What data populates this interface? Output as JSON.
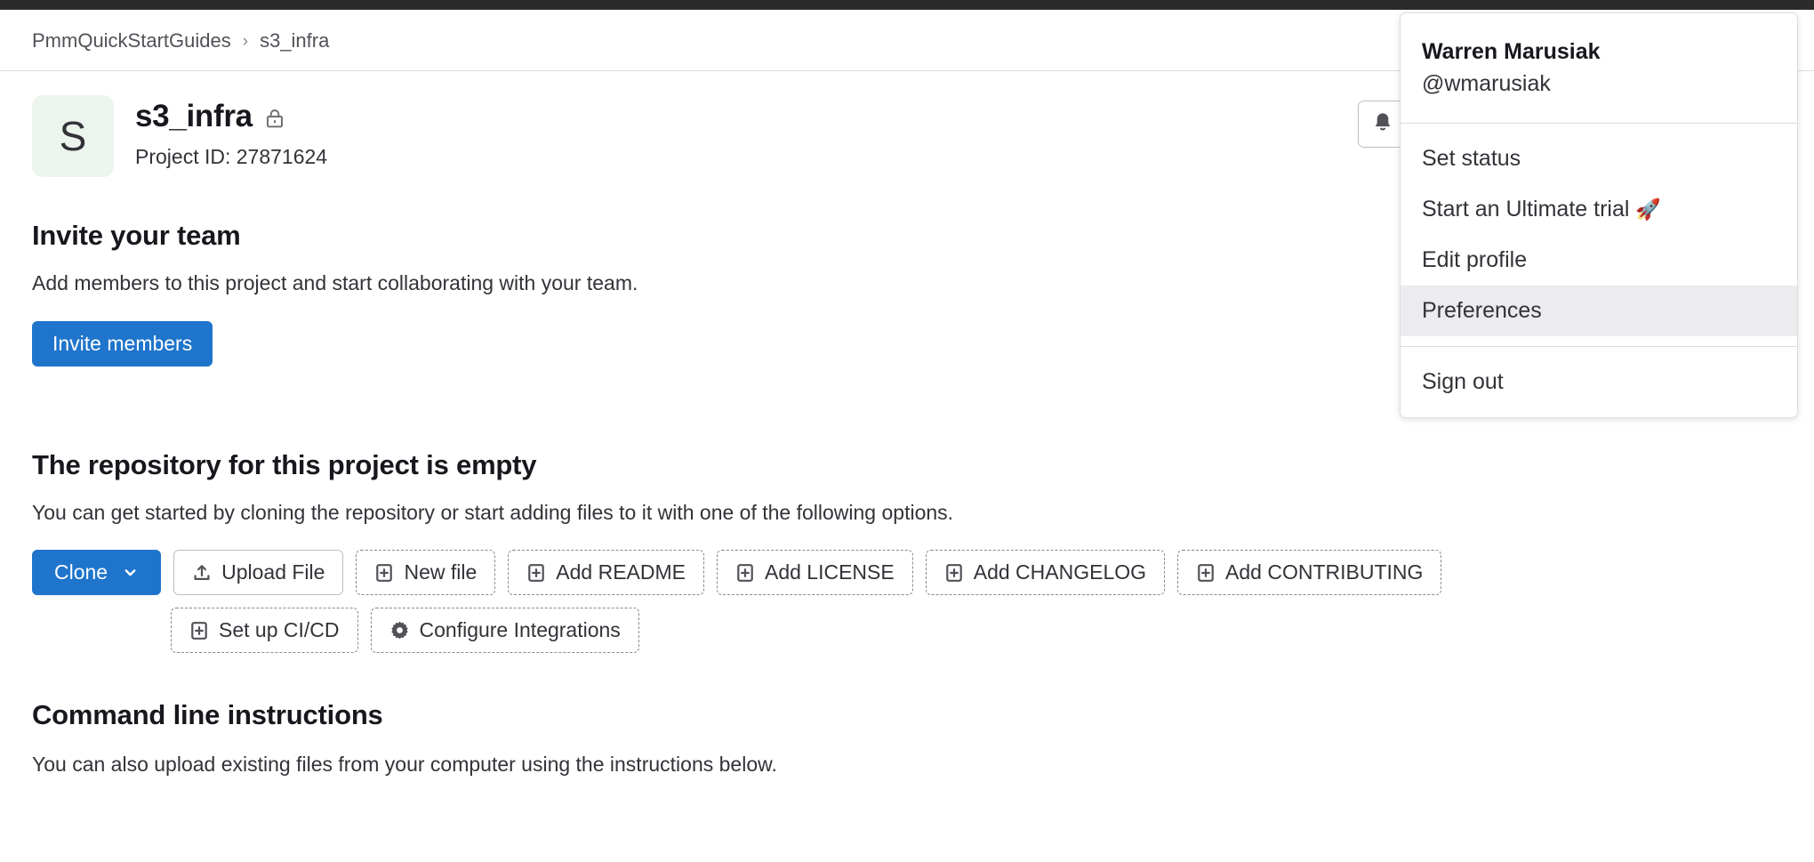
{
  "breadcrumb": {
    "items": [
      {
        "label": "PmmQuickStartGuides"
      },
      {
        "label": "s3_infra"
      }
    ],
    "separator": "›"
  },
  "project": {
    "avatar_letter": "S",
    "avatar_bg": "#ecf4ee",
    "name": "s3_infra",
    "visibility_icon": "lock-icon",
    "project_id_label": "Project ID: 27871624",
    "notifications_icon": "bell-icon"
  },
  "invite_section": {
    "title": "Invite your team",
    "description": "Add members to this project and start collaborating with your team.",
    "button_label": "Invite members",
    "button_color": "#1f75cb"
  },
  "empty_repo_section": {
    "title": "The repository for this project is empty",
    "description": "You can get started by cloning the repository or start adding files to it with one of the following options.",
    "actions_row_one": [
      {
        "label": "Clone",
        "icon": "chevron-down-icon",
        "style": "primary"
      },
      {
        "label": "Upload File",
        "icon": "upload-icon",
        "style": "solid"
      },
      {
        "label": "New file",
        "icon": "plus-square-icon",
        "style": "dashed"
      },
      {
        "label": "Add README",
        "icon": "plus-square-icon",
        "style": "dashed"
      },
      {
        "label": "Add LICENSE",
        "icon": "plus-square-icon",
        "style": "dashed"
      },
      {
        "label": "Add CHANGELOG",
        "icon": "plus-square-icon",
        "style": "dashed"
      },
      {
        "label": "Add CONTRIBUTING",
        "icon": "plus-square-icon",
        "style": "dashed"
      }
    ],
    "actions_row_two": [
      {
        "label": "Set up CI/CD",
        "icon": "plus-square-icon",
        "style": "dashed"
      },
      {
        "label": "Configure Integrations",
        "icon": "gear-icon",
        "style": "dashed"
      }
    ]
  },
  "cli_section": {
    "title": "Command line instructions",
    "description": "You can also upload existing files from your computer using the instructions below."
  },
  "user_dropdown": {
    "name": "Warren Marusiak",
    "handle": "@wmarusiak",
    "group_one": [
      {
        "label": "Set status",
        "active": false
      },
      {
        "label": "Start an Ultimate trial ",
        "emoji": "🚀",
        "active": false
      },
      {
        "label": "Edit profile",
        "active": false
      },
      {
        "label": "Preferences",
        "active": true
      }
    ],
    "group_two": [
      {
        "label": "Sign out",
        "active": false
      }
    ],
    "highlight_color": "#ececef"
  }
}
